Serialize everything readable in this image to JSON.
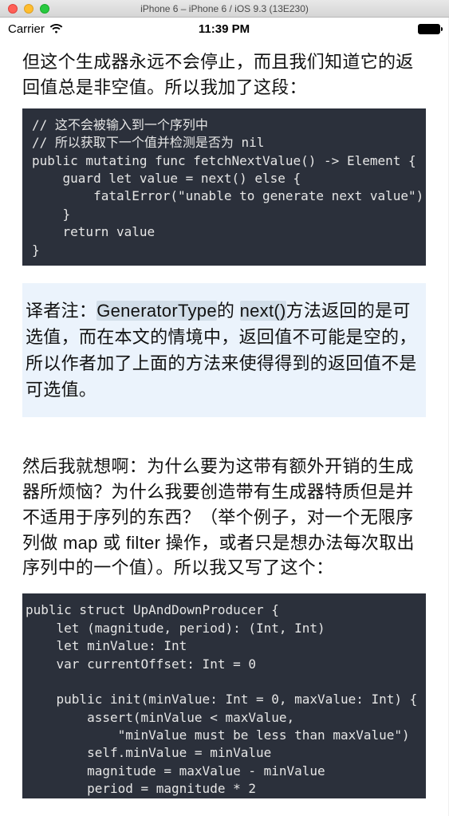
{
  "window": {
    "title": "iPhone 6 – iPhone 6 / iOS 9.3 (13E230)"
  },
  "status_bar": {
    "carrier": "Carrier",
    "time": "11:39 PM"
  },
  "paragraph_1": "但这个生成器永远不会停止，而且我们知道它的返回值总是非空值。所以我加了这段：",
  "code_1": "// 这不会被输入到一个序列中\n// 所以获取下一个值并检测是否为 nil\npublic mutating func fetchNextValue() -> Element {\n    guard let value = next() else {\n        fatalError(\"unable to generate next value\")\n    }\n    return value\n}",
  "note": {
    "label": "译者注：",
    "hl1": "GeneratorType",
    "mid1": "的 ",
    "hl2": "next()",
    "rest": "方法返回的是可选值，而在本文的情境中，返回值不可能是空的，所以作者加了上面的方法来使得得到的返回值不是可选值。"
  },
  "paragraph_2": "然后我就想啊：为什么要为这带有额外开销的生成器所烦恼？为什么我要创造带有生成器特质但是并不适用于序列的东西？（举个例子，对一个无限序列做 map 或 filter 操作，或者只是想办法每次取出序列中的一个值）。所以我又写了这个：",
  "code_2": "public struct UpAndDownProducer {\n    let (magnitude, period): (Int, Int)\n    let minValue: Int\n    var currentOffset: Int = 0\n\n    public init(minValue: Int = 0, maxValue: Int) {\n        assert(minValue < maxValue,\n            \"minValue must be less than maxValue\")\n        self.minValue = minValue\n        magnitude = maxValue - minValue\n        period = magnitude * 2"
}
